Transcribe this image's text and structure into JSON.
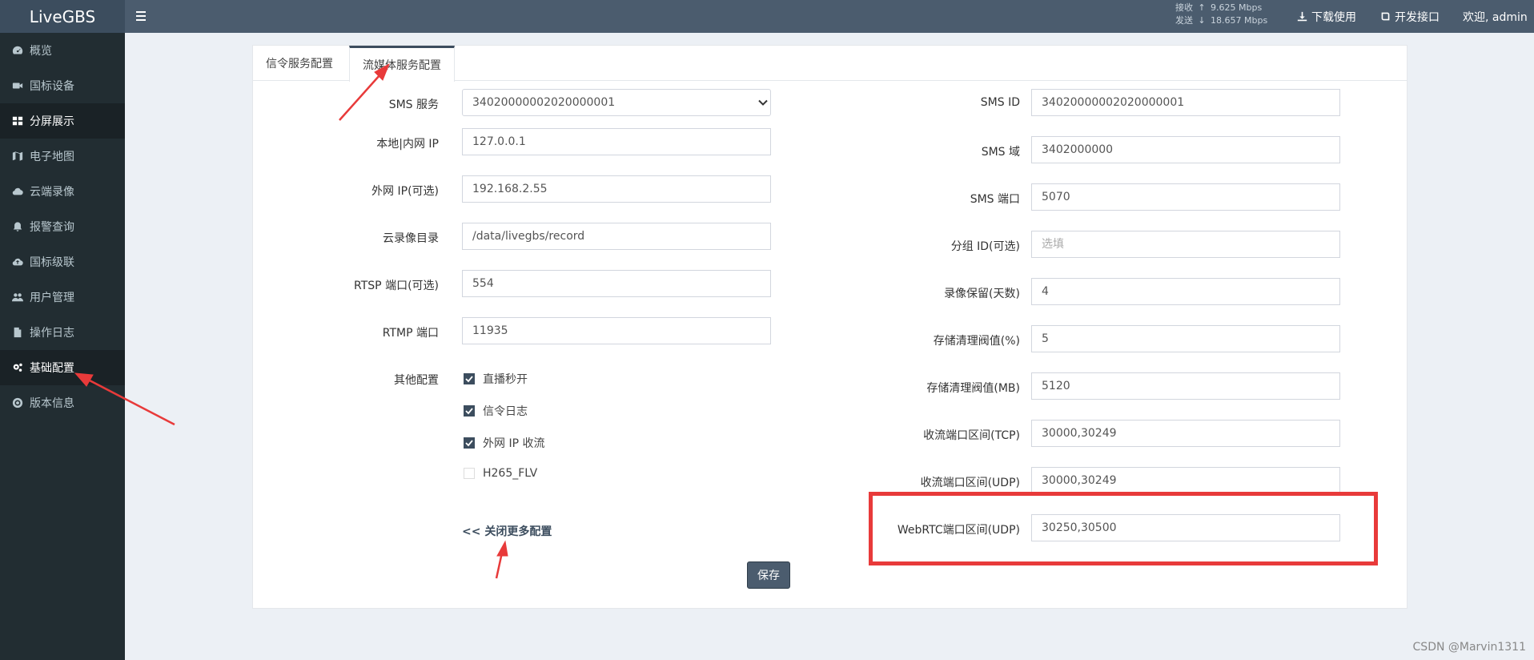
{
  "app": {
    "logo": "LiveGBS"
  },
  "sidebar": {
    "items": [
      {
        "label": "概览",
        "icon": "dashboard-icon"
      },
      {
        "label": "国标设备",
        "icon": "video-camera-icon"
      },
      {
        "label": "分屏展示",
        "icon": "grid-icon"
      },
      {
        "label": "电子地图",
        "icon": "map-icon"
      },
      {
        "label": "云端录像",
        "icon": "cloud-icon"
      },
      {
        "label": "报警查询",
        "icon": "bell-icon"
      },
      {
        "label": "国标级联",
        "icon": "cloud-upload-icon"
      },
      {
        "label": "用户管理",
        "icon": "users-icon"
      },
      {
        "label": "操作日志",
        "icon": "file-icon"
      },
      {
        "label": "基础配置",
        "icon": "gears-icon"
      },
      {
        "label": "版本信息",
        "icon": "lifebuoy-icon"
      }
    ]
  },
  "header": {
    "rx_label": "接收",
    "rx_value": "9.625 Mbps",
    "tx_label": "发送",
    "tx_value": "18.657 Mbps",
    "download": "下载使用",
    "api": "开发接口",
    "welcome": "欢迎, admin"
  },
  "tabs": [
    {
      "label": "信令服务配置"
    },
    {
      "label": "流媒体服务配置"
    }
  ],
  "form": {
    "left": [
      {
        "label": "SMS 服务",
        "value": "34020000002020000001"
      },
      {
        "label": "本地|内网 IP",
        "value": "127.0.0.1"
      },
      {
        "label": "外网 IP(可选)",
        "value": "192.168.2.55"
      },
      {
        "label": "云录像目录",
        "value": "/data/livegbs/record"
      },
      {
        "label": "RTSP 端口(可选)",
        "value": "554"
      },
      {
        "label": "RTMP 端口",
        "value": "11935"
      }
    ],
    "other_label": "其他配置",
    "checks": [
      {
        "label": "直播秒开",
        "checked": true
      },
      {
        "label": "信令日志",
        "checked": true
      },
      {
        "label": "外网 IP 收流",
        "checked": true
      },
      {
        "label": "H265_FLV",
        "checked": false
      }
    ],
    "right": [
      {
        "label": "SMS ID",
        "value": "34020000002020000001",
        "placeholder": ""
      },
      {
        "label": "SMS 域",
        "value": "3402000000",
        "placeholder": ""
      },
      {
        "label": "SMS 端口",
        "value": "5070",
        "placeholder": ""
      },
      {
        "label": "分组 ID(可选)",
        "value": "",
        "placeholder": "选填"
      },
      {
        "label": "录像保留(天数)",
        "value": "4",
        "placeholder": ""
      },
      {
        "label": "存储清理阀值(%)",
        "value": "5",
        "placeholder": ""
      },
      {
        "label": "存储清理阀值(MB)",
        "value": "5120",
        "placeholder": ""
      },
      {
        "label": "收流端口区间(TCP)",
        "value": "30000,30249",
        "placeholder": ""
      },
      {
        "label": "收流端口区间(UDP)",
        "value": "30000,30249",
        "placeholder": ""
      },
      {
        "label": "WebRTC端口区间(UDP)",
        "value": "30250,30500",
        "placeholder": ""
      }
    ],
    "more_link": "<< 关闭更多配置",
    "save": "保存"
  },
  "watermark": "CSDN @Marvin1311",
  "colors": {
    "highlight": "#e83a3a",
    "sidebar": "#222d32",
    "header": "#4b5c6e"
  }
}
